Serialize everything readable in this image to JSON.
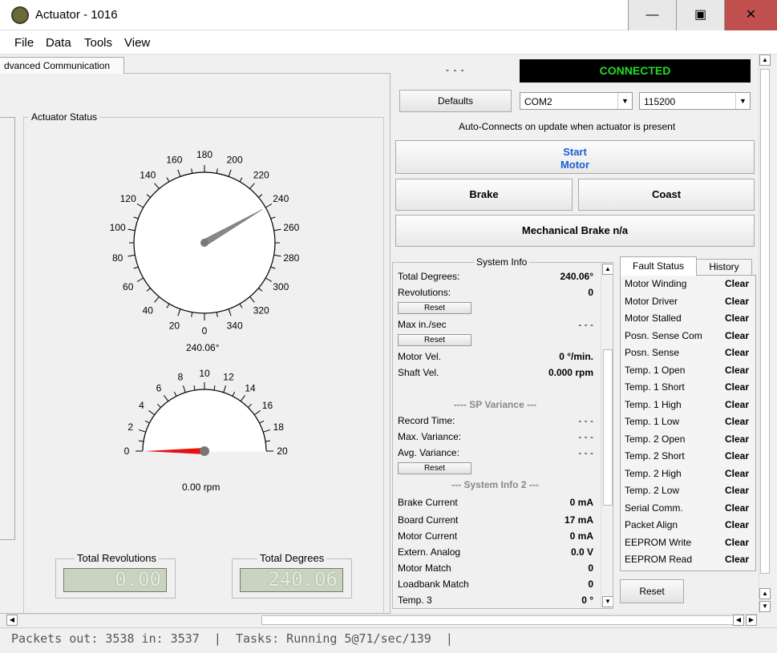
{
  "window": {
    "title": "Actuator - 1016",
    "minimize": "—",
    "maximize": "▣",
    "close": "✕"
  },
  "menu": [
    "File",
    "Data",
    "Tools",
    "View"
  ],
  "tab": {
    "label": "dvanced Communication"
  },
  "actuator_status": {
    "title": "Actuator Status",
    "position_gauge": {
      "labels": [
        "0",
        "20",
        "40",
        "60",
        "80",
        "100",
        "120",
        "140",
        "160",
        "180",
        "200",
        "220",
        "240",
        "260",
        "280",
        "300",
        "320",
        "340"
      ],
      "value_deg": 240.06,
      "readout": "240.06°"
    },
    "speed_gauge": {
      "labels": [
        "0",
        "2",
        "4",
        "6",
        "8",
        "10",
        "12",
        "14",
        "16",
        "18",
        "20"
      ],
      "value_rpm": 0.0,
      "readout": "0.00 rpm"
    },
    "total_revolutions": {
      "label": "Total Revolutions",
      "value": "0.00"
    },
    "total_degrees": {
      "label": "Total Degrees",
      "value": "240.06"
    }
  },
  "connection": {
    "dash": "- - -",
    "status": "CONNECTED",
    "defaults_label": "Defaults",
    "port": "COM2",
    "baud": "115200",
    "note": "Auto-Connects on update when actuator is present"
  },
  "controls": {
    "start_line1": "Start",
    "start_line2": "Motor",
    "brake": "Brake",
    "coast": "Coast",
    "mech_brake": "Mechanical Brake n/a"
  },
  "system_info": {
    "title": "System Info",
    "reset_label": "Reset",
    "total_degrees": {
      "label": "Total Degrees:",
      "value": "240.06°"
    },
    "revolutions": {
      "label": "Revolutions:",
      "value": "0"
    },
    "max_in_sec": {
      "label": "Max in./sec",
      "value": "- - -"
    },
    "motor_vel": {
      "label": "Motor Vel.",
      "value": "0 °/min."
    },
    "shaft_vel": {
      "label": "Shaft Vel.",
      "value": "0.000 rpm"
    },
    "sp_variance_head": "---- SP Variance ---",
    "record_time": {
      "label": "Record Time:",
      "value": "- - -"
    },
    "max_variance": {
      "label": "Max. Variance:",
      "value": "- - -"
    },
    "avg_variance": {
      "label": "Avg. Variance:",
      "value": "- - -"
    },
    "info2_head": "--- System Info 2 ---",
    "brake_current": {
      "label": "Brake Current",
      "value": "0 mA"
    },
    "board_current": {
      "label": "Board Current",
      "value": "17 mA"
    },
    "motor_current": {
      "label": "Motor Current",
      "value": "0 mA"
    },
    "extern_analog": {
      "label": "Extern. Analog",
      "value": "0.0 V"
    },
    "motor_match": {
      "label": "Motor Match",
      "value": "0"
    },
    "loadbank_match": {
      "label": "Loadbank Match",
      "value": "0"
    },
    "temp3": {
      "label": "Temp. 3",
      "value": "0 °"
    }
  },
  "fault": {
    "tab_fault": "Fault Status",
    "tab_history": "History",
    "reset_label": "Reset",
    "items": [
      {
        "label": "Motor Winding",
        "state": "Clear"
      },
      {
        "label": "Motor Driver",
        "state": "Clear"
      },
      {
        "label": "Motor Stalled",
        "state": "Clear"
      },
      {
        "label": "Posn. Sense Com",
        "state": "Clear"
      },
      {
        "label": "Posn. Sense",
        "state": "Clear"
      },
      {
        "label": "Temp. 1 Open",
        "state": "Clear"
      },
      {
        "label": "Temp. 1 Short",
        "state": "Clear"
      },
      {
        "label": "Temp. 1 High",
        "state": "Clear"
      },
      {
        "label": "Temp. 1 Low",
        "state": "Clear"
      },
      {
        "label": "Temp. 2 Open",
        "state": "Clear"
      },
      {
        "label": "Temp. 2 Short",
        "state": "Clear"
      },
      {
        "label": "Temp. 2 High",
        "state": "Clear"
      },
      {
        "label": "Temp. 2 Low",
        "state": "Clear"
      },
      {
        "label": "Serial Comm.",
        "state": "Clear"
      },
      {
        "label": "Packet Align",
        "state": "Clear"
      },
      {
        "label": "EEPROM Write",
        "state": "Clear"
      },
      {
        "label": "EEPROM Read",
        "state": "Clear"
      }
    ]
  },
  "statusbar": {
    "text": "Packets out: 3538 in: 3537  |  Tasks: Running 5@71/sec/139  |"
  },
  "colors": {
    "connected_text": "#22dd22",
    "start_motor_text": "#1a5fd0",
    "speed_needle": "#e81010",
    "close_button": "#c0504d"
  }
}
